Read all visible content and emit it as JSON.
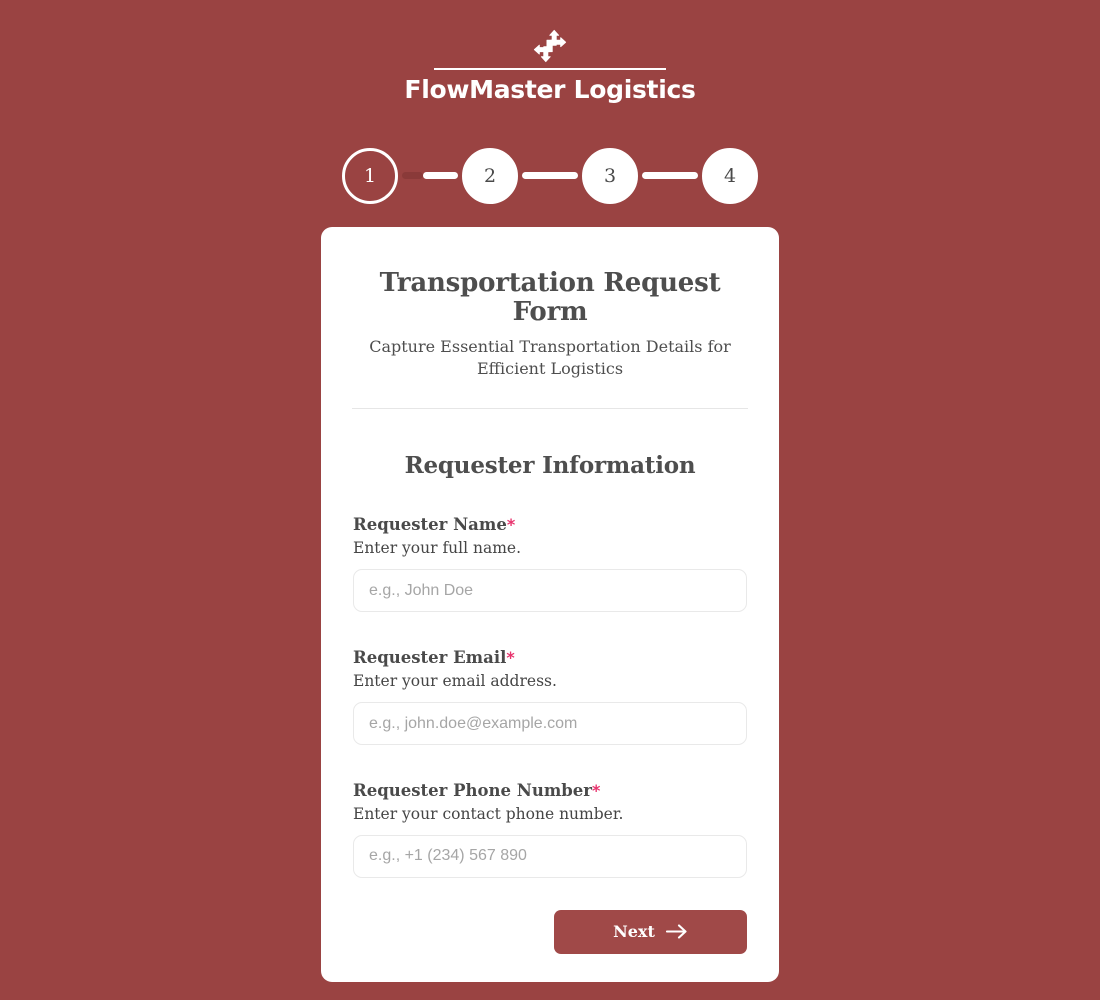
{
  "theme": {
    "page_background": "#9a4342",
    "card_background": "#ffffff",
    "accent": "#a04948",
    "required_marker_color": "#e8336d",
    "text_dark": "#4e4e4e",
    "placeholder_color": "#a6a6a6",
    "border_color": "#e9e9e9"
  },
  "brand": {
    "icon": "four-way-arrows-icon",
    "name": "FlowMaster Logistics"
  },
  "stepper": {
    "current_step": 1,
    "total_steps": 4,
    "steps": [
      {
        "number": "1",
        "state": "active"
      },
      {
        "number": "2",
        "state": "inactive"
      },
      {
        "number": "3",
        "state": "inactive"
      },
      {
        "number": "4",
        "state": "inactive"
      }
    ],
    "connectors": [
      {
        "pending_fraction": 0.38
      },
      {
        "pending_fraction": 0.0
      },
      {
        "pending_fraction": 0.0
      }
    ]
  },
  "form": {
    "title": "Transportation Request Form",
    "subtitle": "Capture Essential Transportation Details for Efficient Logistics",
    "section_heading": "Requester Information",
    "fields": [
      {
        "label": "Requester Name",
        "required_marker": "*",
        "description": "Enter your full name.",
        "placeholder": "e.g., John Doe",
        "value": "",
        "type": "text"
      },
      {
        "label": "Requester Email",
        "required_marker": "*",
        "description": "Enter your email address.",
        "placeholder": "e.g., john.doe@example.com",
        "value": "",
        "type": "email"
      },
      {
        "label": "Requester Phone Number",
        "required_marker": "*",
        "description": "Enter your contact phone number.",
        "placeholder": "e.g., +1 (234) 567 890",
        "value": "",
        "type": "tel"
      }
    ],
    "next_button": {
      "label": "Next",
      "icon": "arrow-right-icon"
    }
  }
}
